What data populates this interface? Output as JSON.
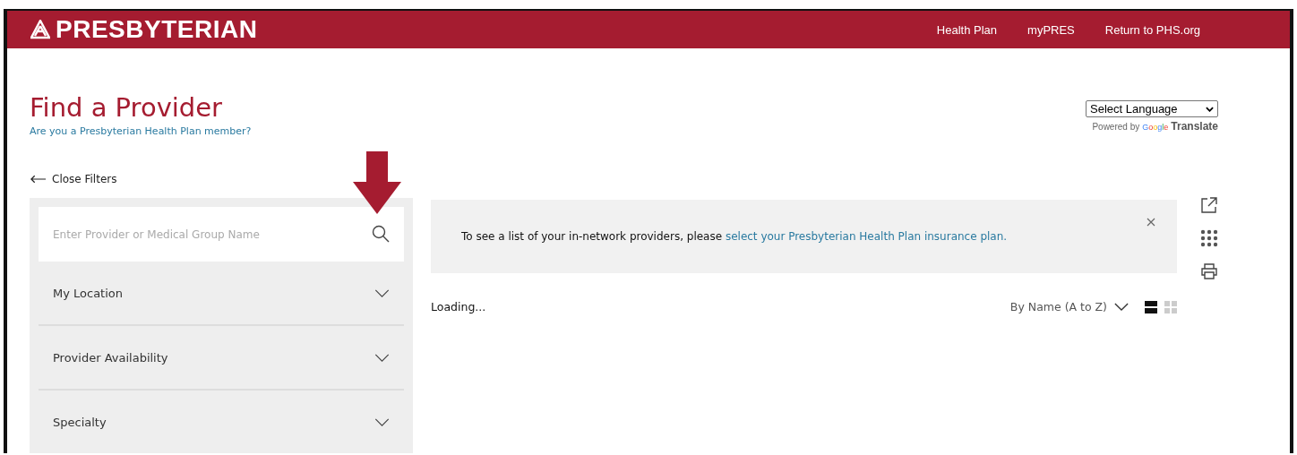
{
  "header": {
    "logo": "PRESBYTERIAN",
    "nav": [
      "Health Plan",
      "myPRES",
      "Return to PHS.org"
    ]
  },
  "title": "Find a Provider",
  "member_link": "Are you a Presbyterian Health Plan member?",
  "language": {
    "select": "Select Language",
    "powered_by": "Powered by",
    "google": "Google",
    "translate": "Translate"
  },
  "close_filters": "Close Filters",
  "search": {
    "placeholder": "Enter Provider or Medical Group Name"
  },
  "filters": [
    {
      "label": "My Location",
      "expanded": false
    },
    {
      "label": "Provider Availability",
      "expanded": false
    },
    {
      "label": "Specialty",
      "expanded": false
    }
  ],
  "notice": {
    "text": "To see a list of your in-network providers, please ",
    "link": "select your Presbyterian Health Plan insurance plan."
  },
  "status": "Loading...",
  "sort": "By Name (A to Z)",
  "view_modes": [
    {
      "kind": "list",
      "selected": true
    },
    {
      "kind": "grid",
      "selected": false
    }
  ]
}
